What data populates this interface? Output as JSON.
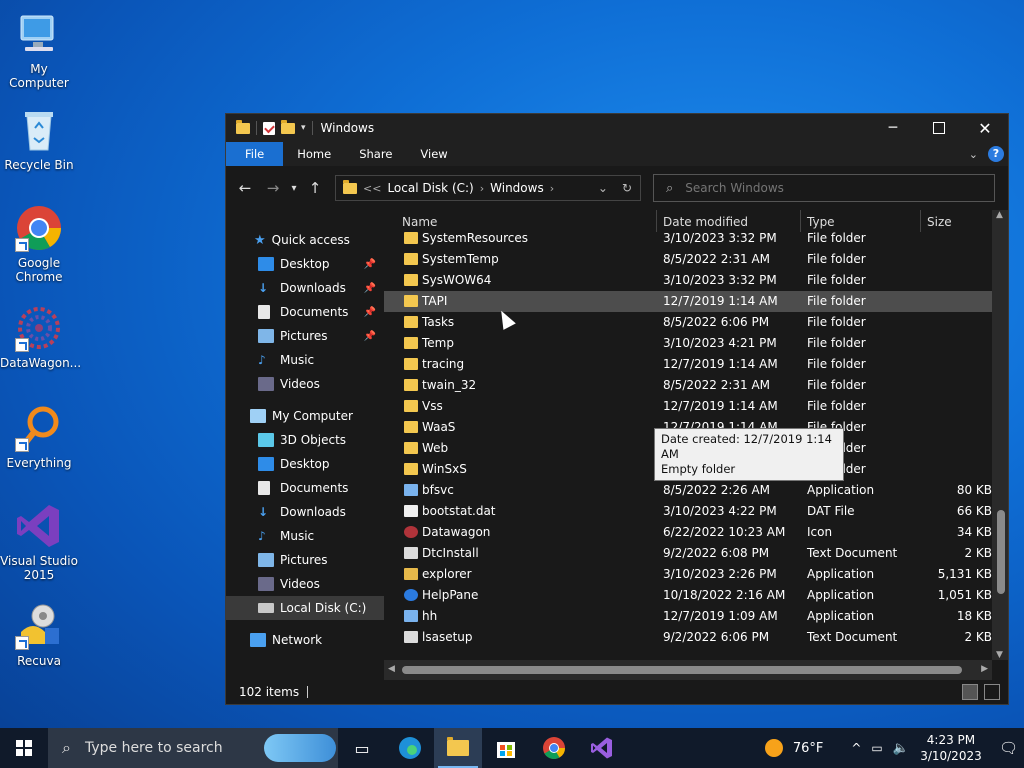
{
  "desktop": {
    "icons": [
      {
        "label": "My Computer"
      },
      {
        "label": "Recycle Bin"
      },
      {
        "label": "Google Chrome"
      },
      {
        "label": "DataWagon..."
      },
      {
        "label": "Everything"
      },
      {
        "label": "Visual Studio 2015"
      },
      {
        "label": "Recuva"
      }
    ]
  },
  "window": {
    "title": "Windows",
    "ribbon_tabs": [
      "File",
      "Home",
      "Share",
      "View"
    ],
    "help_label": "?",
    "address": {
      "crumbs": [
        "Local Disk (C:)",
        "Windows"
      ],
      "prefix": "<<"
    },
    "search_placeholder": "Search Windows",
    "nav": {
      "quick_access": "Quick access",
      "quick_items": [
        "Desktop",
        "Downloads",
        "Documents",
        "Pictures",
        "Music",
        "Videos"
      ],
      "my_computer": "My Computer",
      "computer_items": [
        "3D Objects",
        "Desktop",
        "Documents",
        "Downloads",
        "Music",
        "Pictures",
        "Videos",
        "Local Disk (C:)"
      ],
      "network": "Network"
    },
    "columns": {
      "name": "Name",
      "date": "Date modified",
      "type": "Type",
      "size": "Size"
    },
    "files": [
      {
        "name": "SystemResources",
        "date": "3/10/2023 3:32 PM",
        "type": "File folder",
        "size": "",
        "kind": "folder"
      },
      {
        "name": "SystemTemp",
        "date": "8/5/2022 2:31 AM",
        "type": "File folder",
        "size": "",
        "kind": "folder"
      },
      {
        "name": "SysWOW64",
        "date": "3/10/2023 3:32 PM",
        "type": "File folder",
        "size": "",
        "kind": "folder"
      },
      {
        "name": "TAPI",
        "date": "12/7/2019 1:14 AM",
        "type": "File folder",
        "size": "",
        "kind": "folder"
      },
      {
        "name": "Tasks",
        "date": "8/5/2022 6:06 PM",
        "type": "File folder",
        "size": "",
        "kind": "folder"
      },
      {
        "name": "Temp",
        "date": "3/10/2023 4:21 PM",
        "type": "File folder",
        "size": "",
        "kind": "folder"
      },
      {
        "name": "tracing",
        "date": "12/7/2019 1:14 AM",
        "type": "File folder",
        "size": "",
        "kind": "folder"
      },
      {
        "name": "twain_32",
        "date": "8/5/2022 2:31 AM",
        "type": "File folder",
        "size": "",
        "kind": "folder"
      },
      {
        "name": "Vss",
        "date": "12/7/2019 1:14 AM",
        "type": "File folder",
        "size": "",
        "kind": "folder"
      },
      {
        "name": "WaaS",
        "date": "12/7/2019 1:14 AM",
        "type": "File folder",
        "size": "",
        "kind": "folder"
      },
      {
        "name": "Web",
        "date": "12/7/2019 1:31 AM",
        "type": "File folder",
        "size": "",
        "kind": "folder"
      },
      {
        "name": "WinSxS",
        "date": "3/10/2023 3:34 PM",
        "type": "File folder",
        "size": "",
        "kind": "folder"
      },
      {
        "name": "bfsvc",
        "date": "8/5/2022 2:26 AM",
        "type": "Application",
        "size": "80 KB",
        "kind": "app"
      },
      {
        "name": "bootstat.dat",
        "date": "3/10/2023 4:22 PM",
        "type": "DAT File",
        "size": "66 KB",
        "kind": "file"
      },
      {
        "name": "Datawagon",
        "date": "6/22/2022 10:23 AM",
        "type": "Icon",
        "size": "34 KB",
        "kind": "wagon"
      },
      {
        "name": "DtcInstall",
        "date": "9/2/2022 6:08 PM",
        "type": "Text Document",
        "size": "2 KB",
        "kind": "text"
      },
      {
        "name": "explorer",
        "date": "3/10/2023 2:26 PM",
        "type": "Application",
        "size": "5,131 KB",
        "kind": "explorer"
      },
      {
        "name": "HelpPane",
        "date": "10/18/2022 2:16 AM",
        "type": "Application",
        "size": "1,051 KB",
        "kind": "help"
      },
      {
        "name": "hh",
        "date": "12/7/2019 1:09 AM",
        "type": "Application",
        "size": "18 KB",
        "kind": "app"
      },
      {
        "name": "lsasetup",
        "date": "9/2/2022 6:06 PM",
        "type": "Text Document",
        "size": "2 KB",
        "kind": "text"
      }
    ],
    "hovered_row": 3,
    "tooltip": {
      "line1": "Date created: 12/7/2019 1:14 AM",
      "line2": "Empty folder"
    },
    "status": "102 items"
  },
  "taskbar": {
    "search_placeholder": "Type here to search",
    "weather": "76°F",
    "time": "4:23 PM",
    "date": "3/10/2023"
  },
  "colors": {
    "folder": "#f3c74f",
    "accent": "#1a6fd1",
    "taskbar": "#101a2a"
  }
}
